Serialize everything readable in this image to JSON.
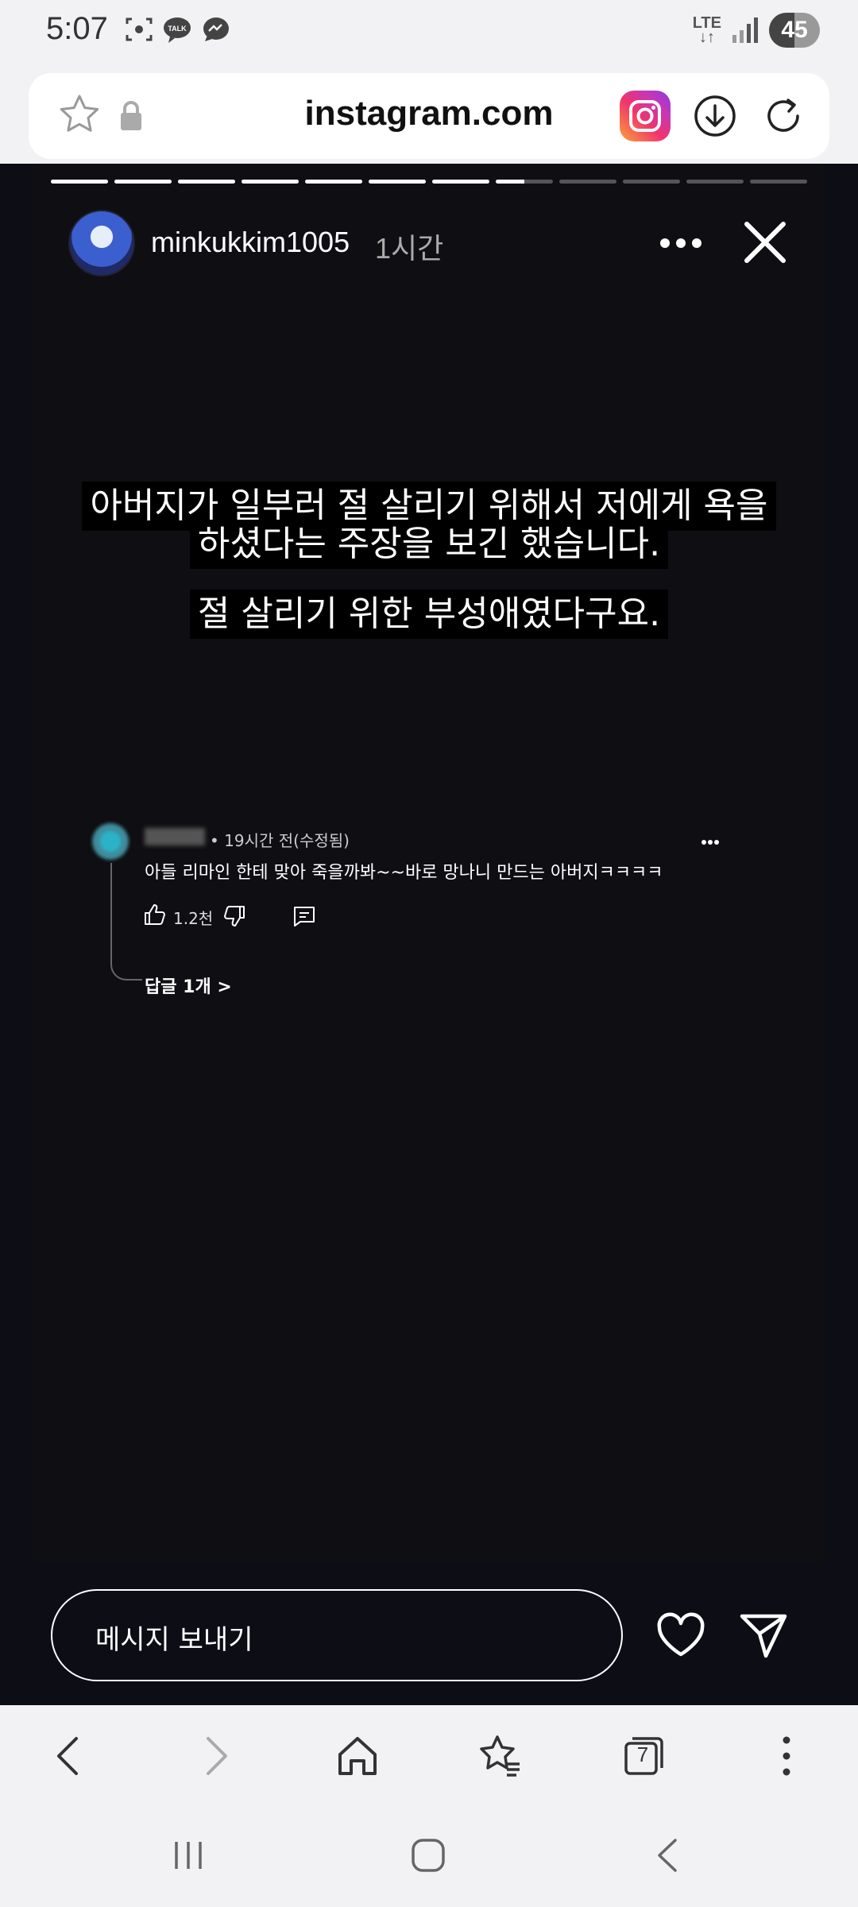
{
  "status_bar": {
    "time": "5:07",
    "network": "LTE",
    "battery": "45",
    "left_icons": [
      "screenshot-icon",
      "kakaotalk-icon",
      "messenger-icon"
    ]
  },
  "url_bar": {
    "url": "instagram.com"
  },
  "story": {
    "progress_segments": 12,
    "progress_completed": 7,
    "progress_current_fraction": 0.5,
    "username": "minkukkim1005",
    "time_ago": "1시간",
    "caption_line1": "아버지가 일부러 절 살리기 위해서 저에게 욕을",
    "caption_line2": "하셨다는 주장을 보긴 했습니다.",
    "caption_line3": "절 살리기 위한 부성애였다구요.",
    "comment": {
      "meta": "• 19시간 전(수정됨)",
      "text": "아들 리마인 한테 맞아 죽을까봐~~바로 망나니 만드는 아버지ㅋㅋㅋㅋ",
      "likes": "1.2천",
      "replies": "답글 1개 >"
    }
  },
  "message_bar": {
    "placeholder": "메시지 보내기"
  },
  "toolbar": {
    "tabs_count": "7"
  }
}
